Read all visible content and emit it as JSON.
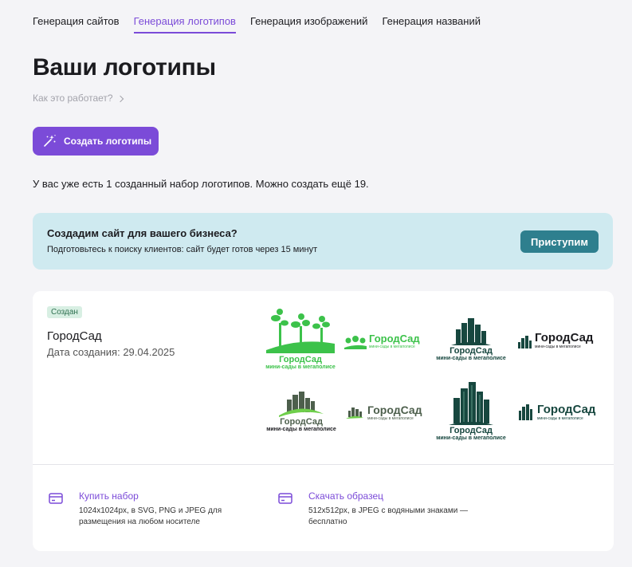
{
  "nav": {
    "tabs": [
      {
        "label": "Генерация сайтов"
      },
      {
        "label": "Генерация логотипов"
      },
      {
        "label": "Генерация изображений"
      },
      {
        "label": "Генерация названий"
      }
    ],
    "active_tab": 1
  },
  "page": {
    "title": "Ваши логотипы",
    "how_it_works": "Как это работает?",
    "create_button": "Создать логотипы",
    "info": "У вас уже есть 1 созданный набор логотипов. Можно создать ещё 19."
  },
  "promo": {
    "title": "Создадим сайт для вашего бизнеса?",
    "subtitle": "Подготовьтесь к поиску клиентов: сайт будет готов через 15 минут",
    "button": "Приступим"
  },
  "logo_set": {
    "status": "Создан",
    "name": "ГородСад",
    "date": "Дата создания: 29.04.2025",
    "brand": "ГородСад",
    "tagline": "мини-сады в мегаполисе",
    "colors": {
      "green": "#3cc24a",
      "dark_teal": "#17473f",
      "gray_green": "#4d5f4c",
      "light_green": "#6fcf4b"
    }
  },
  "actions": {
    "buy": {
      "title": "Купить набор",
      "desc": "1024x1024px, в SVG, PNG и JPEG для размещения на любом носителе"
    },
    "sample": {
      "title": "Скачать образец",
      "desc": "512x512px, в JPEG с водяными знаками — бесплатно"
    }
  },
  "colors": {
    "accent": "#7b4bd8",
    "promo_bg": "#cfeaf0",
    "promo_button": "#2e7f8e",
    "badge_bg": "#d8efe3"
  }
}
